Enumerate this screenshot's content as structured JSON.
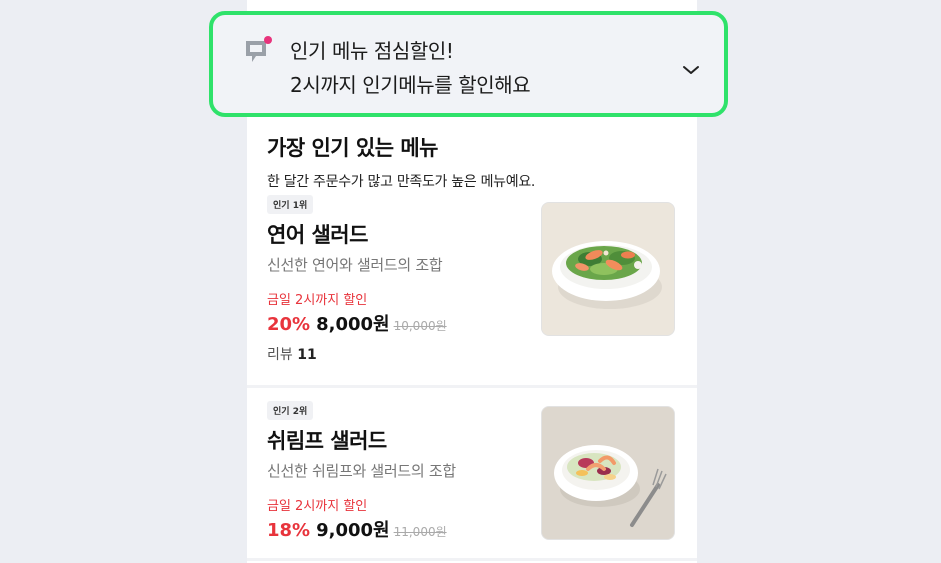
{
  "banner": {
    "icon": "chat-bubble-notification-icon",
    "line1": "인기 메뉴 점심할인!",
    "line2": "2시까지 인기메뉴를 할인해요",
    "expand_icon": "chevron-down-icon"
  },
  "section": {
    "title": "가장 인기 있는 메뉴",
    "subtitle": "한 달간 주문수가 많고 만족도가 높은 메뉴예요."
  },
  "menu_items": [
    {
      "rank_badge": "인기 1위",
      "name": "연어 샐러드",
      "description": "신선한 연어와 샐러드의 조합",
      "deal_label": "금일 2시까지 할인",
      "discount": "20%",
      "price": "8,000원",
      "original_price": "10,000원",
      "review_label": "리뷰",
      "review_count": "11",
      "image": "salmon-salad-image"
    },
    {
      "rank_badge": "인기 2위",
      "name": "쉬림프 샐러드",
      "description": "신선한 쉬림프와 샐러드의 조합",
      "deal_label": "금일 2시까지 할인",
      "discount": "18%",
      "price": "9,000원",
      "original_price": "11,000원",
      "image": "shrimp-salad-image"
    }
  ],
  "colors": {
    "accent_red": "#e8343c",
    "banner_border": "#2fe26a",
    "notification_dot": "#e8337c"
  }
}
